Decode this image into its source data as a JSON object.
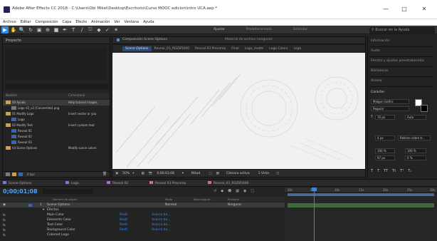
{
  "window": {
    "title": "Adobe After Effects CC 2018 - C:\\Users\\Obi Mikel\\Desktop\\Escritorio\\Curso MOOC edicion\\intro UCA.aep *",
    "minimize": "—",
    "maximize": "□",
    "close": "✕"
  },
  "menubar": [
    "Archivo",
    "Editar",
    "Composición",
    "Capa",
    "Efecto",
    "Animación",
    "Ver",
    "Ventana",
    "Ayuda"
  ],
  "toolbar": {
    "workspaces": [
      "Ajustar",
      "Predeterminado",
      "Estándar"
    ],
    "search_placeholder": "Buscar en la Ayuda"
  },
  "project": {
    "title": "Proyecto",
    "col_name": "Nombre",
    "col_comment": "Comentario",
    "items": [
      {
        "name": "00 Ayuda",
        "comment": "Help tutorial images"
      },
      {
        "name": "Logo V2_v2 [Convertido].png",
        "comment": ""
      },
      {
        "name": "01 Modify Logo",
        "comment": "Insert vector or you"
      },
      {
        "name": "Logo",
        "comment": ""
      },
      {
        "name": "02 Modify Text",
        "comment": "Insert custom text"
      },
      {
        "name": "Reveal 01",
        "comment": ""
      },
      {
        "name": "Reveal 02",
        "comment": ""
      },
      {
        "name": "Reveal 03",
        "comment": ""
      },
      {
        "name": "03 Scene Options",
        "comment": "Modify scene colors"
      }
    ],
    "bpc": "8 bpc"
  },
  "composition": {
    "tab_label": "Composición Scene Options",
    "tab_extra": "Material de archivo (ninguno)",
    "breadcrumbs": [
      "Scene Options",
      "Reveal_03_ROZ85000",
      "Reveal 03 Precomp",
      "Final",
      "Logo_matte",
      "Logo Colors",
      "Logo"
    ],
    "zoom": "50%",
    "timecode": "0;00;01;08",
    "resolution": "Mitad",
    "camera": "Cámara activa",
    "views": "1 Vista"
  },
  "right_panel": {
    "sections": [
      "Información",
      "Audio",
      "Efectos y ajustes preestablecidos",
      "Bibliotecas",
      "Alinear",
      "Carácter"
    ],
    "font": "Malgun Gothic",
    "style": "Regular",
    "size": "70 px",
    "leading": "Auto",
    "stroke": "4 px",
    "stroke_mode": "Relleno sobre tr...",
    "scale_v": "100 %",
    "scale_h": "100 %",
    "baseline": "97 px",
    "tsume": "0 %"
  },
  "timeline": {
    "tabs": [
      {
        "label": "Scene Options",
        "color": "#6b7fd6"
      },
      {
        "label": "Logo",
        "color": "#6b7fd6"
      },
      {
        "label": "Reveal 02",
        "color": "#b070c0"
      },
      {
        "label": "Reveal 03 Precomp",
        "color": "#c76fa8"
      },
      {
        "label": "Reveal_03_ROZ85000",
        "color": "#c76fa8"
      }
    ],
    "timecode": "0;00;01;08",
    "columns": [
      "Nombre de origen",
      "Modo",
      "Mate seguim",
      "Primario"
    ],
    "layer_name": "Scene Options",
    "layer_mode": "Normal",
    "layer_parent": "Ninguno",
    "effects_label": "Efectos",
    "props": [
      {
        "name": "Main Color",
        "value": "Restl",
        "expr": "Acerca de..."
      },
      {
        "name": "Elements Color",
        "value": "Restl",
        "expr": "Acerca de..."
      },
      {
        "name": "Text Color",
        "value": "Restl",
        "expr": "Acerca de..."
      },
      {
        "name": "Background Color",
        "value": "Restl",
        "expr": "Acerca de..."
      },
      {
        "name": "Colorset Logo",
        "value": "",
        "expr": ""
      }
    ],
    "ruler": [
      "00s",
      "05s",
      "10s",
      "15s",
      "20s",
      "25s",
      "30s"
    ]
  }
}
